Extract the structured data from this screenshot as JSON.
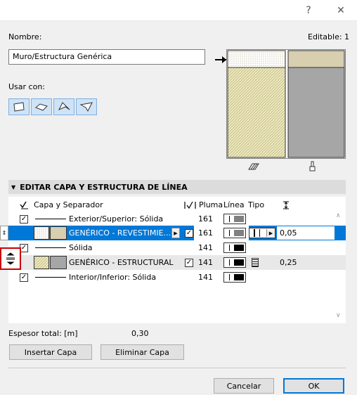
{
  "titlebar": {
    "help_icon": "?",
    "close_icon": "✕"
  },
  "name_label": "Nombre:",
  "editable_label": "Editable: 1",
  "name_value": "Muro/Estructura Genérica",
  "use_with_label": "Usar con:",
  "section_title": "EDITAR CAPA Y ESTRUCTURA DE LÍNEA",
  "columns": {
    "layer": "Capa y Separador",
    "pen": "Pluma",
    "line": "Línea",
    "type": "Tipo"
  },
  "rows": [
    {
      "label": "Exterior/Superior: Sólida",
      "pen": "161"
    },
    {
      "label": "GENÉRICO - REVESTIMIE...",
      "pen": "161",
      "thickness": "0,05"
    },
    {
      "label": "Sólida",
      "pen": "141"
    },
    {
      "label": "GENÉRICO - ESTRUCTURAL",
      "pen": "141",
      "thickness": "0,25"
    },
    {
      "label": "Interior/Inferior: Sólida",
      "pen": "141"
    }
  ],
  "total_label": "Espesor total: [m]",
  "total_value": "0,30",
  "buttons": {
    "insert": "Insertar Capa",
    "delete": "Eliminar Capa",
    "cancel": "Cancelar",
    "ok": "OK"
  },
  "colors": {
    "selection": "#0078d7",
    "finish_fill": "#d8ceb0",
    "structure_fill": "#a6a6a6",
    "hatch_fill": "#ece8c0"
  }
}
